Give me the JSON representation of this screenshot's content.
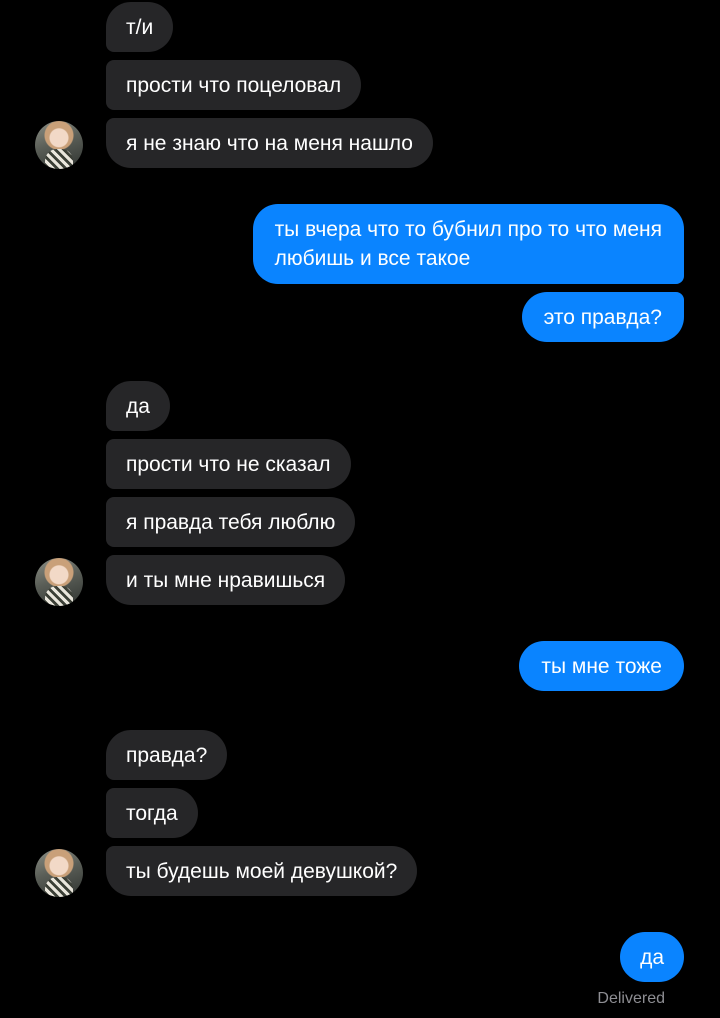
{
  "conversation": {
    "messages": [
      {
        "sender": "them",
        "text": "т/и"
      },
      {
        "sender": "them",
        "text": "прости что поцеловал"
      },
      {
        "sender": "them",
        "text": "я не знаю что на меня нашло"
      },
      {
        "sender": "me",
        "lines": [
          "ты вчера что то бубнил про то что меня",
          "любишь и все такое"
        ]
      },
      {
        "sender": "me",
        "text": "это правда?"
      },
      {
        "sender": "them",
        "text": "да"
      },
      {
        "sender": "them",
        "text": "прости что не сказал"
      },
      {
        "sender": "them",
        "text": "я правда тебя люблю"
      },
      {
        "sender": "them",
        "text": "и ты мне нравишься"
      },
      {
        "sender": "me",
        "text": "ты мне тоже"
      },
      {
        "sender": "them",
        "text": "правда?"
      },
      {
        "sender": "them",
        "text": "тогда"
      },
      {
        "sender": "them",
        "text": "ты будешь моей девушкой?"
      },
      {
        "sender": "me",
        "text": "да"
      }
    ],
    "status": "Delivered"
  },
  "theme": {
    "background": "#000000",
    "incoming_bubble": "#262628",
    "outgoing_bubble": "#0a84ff",
    "text": "#ffffff",
    "status_text": "#8e8e93"
  }
}
